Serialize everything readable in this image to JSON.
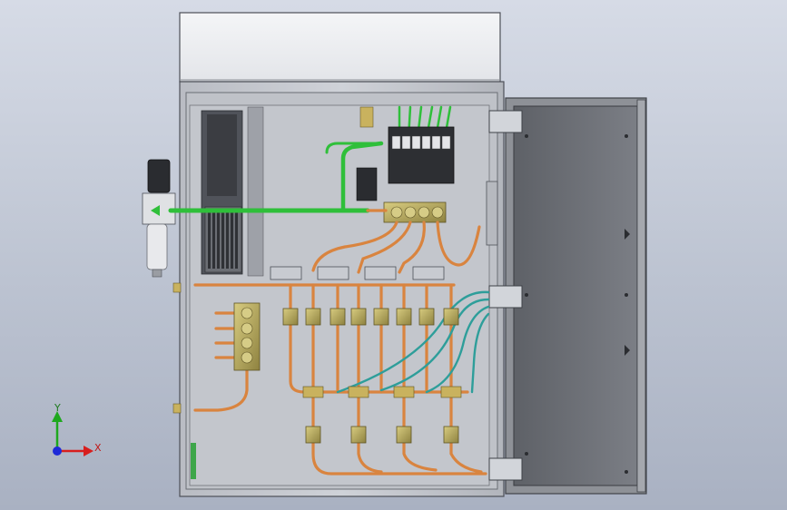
{
  "scene": {
    "background_top": "#d6dbe6",
    "background_bottom": "#a9b1c2",
    "colors": {
      "enclosure": "#c9ccd2",
      "enclosure_edge": "#5a5e66",
      "backplate": "#b4b8bf",
      "door_panel": "#6e7177",
      "air_line": "#2fbf3a",
      "copper": "#d9843f",
      "teal_line": "#2e9e9a",
      "brass": "#b8a85a",
      "terminal": "#3b3d42"
    }
  },
  "triad": {
    "x_label": "X",
    "y_label": "Y",
    "x_color": "#d81e1e",
    "y_color": "#1ea81e",
    "z_color": "#1e2ad8"
  }
}
